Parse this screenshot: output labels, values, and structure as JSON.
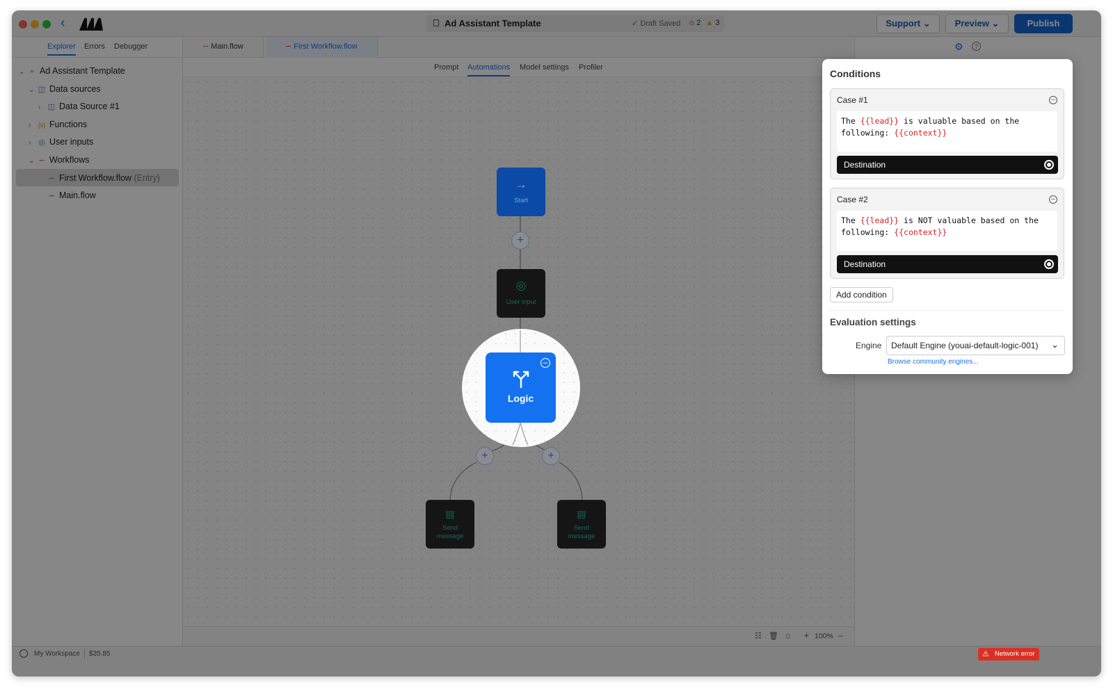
{
  "window": {
    "title": "Ad Assistant Template",
    "draft_status": "✓ Draft Saved",
    "error_count": "2",
    "warning_count": "3"
  },
  "toolbar": {
    "support_label": "Support",
    "preview_label": "Preview",
    "publish_label": "Publish"
  },
  "sidebar": {
    "tabs": [
      "Explorer",
      "Errors",
      "Debugger"
    ],
    "tree": {
      "root": "Ad Assistant Template",
      "data_sources": "Data sources",
      "data_source_1": "Data Source #1",
      "functions": "Functions",
      "user_inputs": "User inputs",
      "workflows": "Workflows",
      "first_workflow": "First Workflow.flow",
      "first_workflow_tag": "(Entry)",
      "main_flow": "Main.flow"
    }
  },
  "file_tabs": [
    "Main.flow",
    "First Workflow.flow"
  ],
  "sub_tabs": [
    "Prompt",
    "Automations",
    "Model settings",
    "Profiler"
  ],
  "nodes": {
    "start": "Start",
    "user_input": "User input",
    "logic": "Logic",
    "send_left": "Send message",
    "send_right": "Send message"
  },
  "canvas_controls": {
    "zoom": "100%"
  },
  "conditions_panel": {
    "title": "Conditions",
    "cases": [
      {
        "label": "Case #1",
        "text_pre": "The ",
        "var1": "{{lead}}",
        "text_mid": " is valuable based on the following: ",
        "var2": "{{context}}",
        "destination": "Destination"
      },
      {
        "label": "Case #2",
        "text_pre": "The ",
        "var1": "{{lead}}",
        "text_mid": " is NOT valuable based on the following: ",
        "var2": "{{context}}",
        "destination": "Destination"
      }
    ],
    "add_condition": "Add condition",
    "evaluation_title": "Evaluation settings",
    "engine_label": "Engine",
    "engine_value": "Default Engine (youai-default-logic-001)",
    "browse_link": "Browse community engines..."
  },
  "status": {
    "workspace": "My Workspace",
    "balance": "$35.85",
    "network_error": "Network error"
  },
  "colors": {
    "accent": "#1366d6",
    "logic_node": "#1472f0",
    "variable": "#dd2222",
    "error": "#d93025"
  }
}
